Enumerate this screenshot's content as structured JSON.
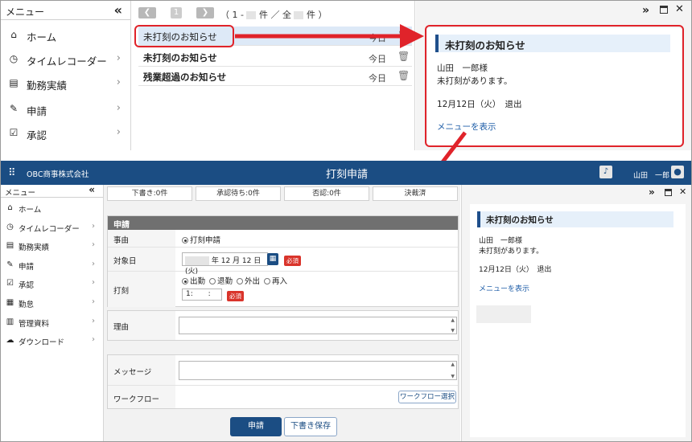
{
  "top": {
    "menu": {
      "title": "メニュー",
      "collapse": "«",
      "items": [
        {
          "label": "ホーム",
          "icon": "home-icon",
          "glyph": "⌂",
          "chevron": false
        },
        {
          "label": "タイムレコーダー",
          "icon": "clock-icon",
          "glyph": "◷",
          "chevron": true
        },
        {
          "label": "勤務実績",
          "icon": "document-icon",
          "glyph": "▤",
          "chevron": true
        },
        {
          "label": "申請",
          "icon": "edit-document-icon",
          "glyph": "✎",
          "chevron": true
        },
        {
          "label": "承認",
          "icon": "approval-icon",
          "glyph": "☑",
          "chevron": true
        }
      ]
    },
    "pager": {
      "prev": "❮",
      "page": "1",
      "next": "❯",
      "open": "（ 1 -",
      "count_unit": "件 ／ 全",
      "total_unit": "件 ）"
    },
    "notices": [
      {
        "title": "未打刻のお知らせ",
        "date": "今日"
      },
      {
        "title": "未打刻のお知らせ",
        "date": "今日"
      },
      {
        "title": "残業超過のお知らせ",
        "date": "今日"
      }
    ],
    "detail": {
      "expand": "»",
      "title": "未打刻のお知らせ",
      "recipient": "山田　一郎様",
      "body": "未打刻があります。",
      "date_line": "12月12日（火）　退出",
      "link": "メニューを表示"
    }
  },
  "bottom": {
    "header": {
      "company": "OBC商事株式会社",
      "title": "打刻申請",
      "user": "山田　一郎"
    },
    "menu": {
      "title": "メニュー",
      "collapse": "«",
      "items": [
        {
          "label": "ホーム",
          "icon": "home-icon",
          "glyph": "⌂",
          "chevron": false
        },
        {
          "label": "タイムレコーダー",
          "icon": "clock-icon",
          "glyph": "◷",
          "chevron": true
        },
        {
          "label": "勤務実績",
          "icon": "document-icon",
          "glyph": "▤",
          "chevron": true
        },
        {
          "label": "申請",
          "icon": "edit-document-icon",
          "glyph": "✎",
          "chevron": true
        },
        {
          "label": "承認",
          "icon": "approval-icon",
          "glyph": "☑",
          "chevron": true
        },
        {
          "label": "勤怠",
          "icon": "calendar-icon",
          "glyph": "▦",
          "chevron": true
        },
        {
          "label": "管理資料",
          "icon": "books-icon",
          "glyph": "▥",
          "chevron": true
        },
        {
          "label": "ダウンロード",
          "icon": "cloud-download-icon",
          "glyph": "☁",
          "chevron": true
        }
      ]
    },
    "counters": [
      {
        "label": "下書き:0件"
      },
      {
        "label": "承認待ち:0件"
      },
      {
        "label": "否認:0件"
      },
      {
        "label": "決裁済"
      }
    ],
    "form": {
      "section_title": "申請",
      "reason_type_label": "事由",
      "reason_type_value": "打刻申請",
      "target_date_label": "対象日",
      "target_date_value": "年 12 月 12 日(火)",
      "required": "必須",
      "punch_label": "打刻",
      "punch_options": [
        "出勤",
        "退勤",
        "外出",
        "再入"
      ],
      "time_value": "1:",
      "time_sep": ":",
      "reason_label": "理由",
      "message_label": "メッセージ",
      "workflow_label": "ワークフロー",
      "workflow_button": "ワークフロー選択",
      "submit_button": "申請",
      "draft_button": "下書き保存"
    },
    "detail": {
      "expand": "»",
      "title": "未打刻のお知らせ",
      "recipient": "山田　一郎様",
      "body": "未打刻があります。",
      "date_line": "12月12日（火）　退出",
      "link": "メニューを表示"
    }
  },
  "colors": {
    "header": "#1b4d83",
    "highlight": "#e0232a",
    "accent": "#1f4f8b",
    "required": "#d9342b"
  }
}
